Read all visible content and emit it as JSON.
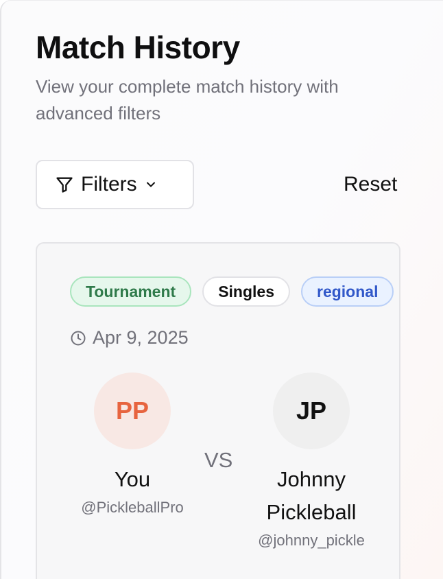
{
  "header": {
    "title": "Match History",
    "subtitle": "View your complete match history with advanced filters"
  },
  "toolbar": {
    "filters_label": "Filters",
    "filters_icon": "filter-funnel-icon",
    "dropdown_icon": "chevron-down-icon",
    "reset_label": "Reset"
  },
  "match": {
    "tags": [
      {
        "label": "Tournament",
        "color": "#2f7a4a"
      },
      {
        "label": "Singles",
        "color": "#111111"
      },
      {
        "label": "regional",
        "color": "#3158c9"
      }
    ],
    "date_icon": "clock-icon",
    "date": "Apr 9, 2025",
    "vs_label": "VS",
    "player": {
      "initials": "PP",
      "name": "You",
      "handle": "@PickleballPro",
      "accent": "#e7643f"
    },
    "opponent": {
      "initials": "JP",
      "name": "Johnny Pickleball",
      "handle": "@johnny_pickle"
    }
  }
}
